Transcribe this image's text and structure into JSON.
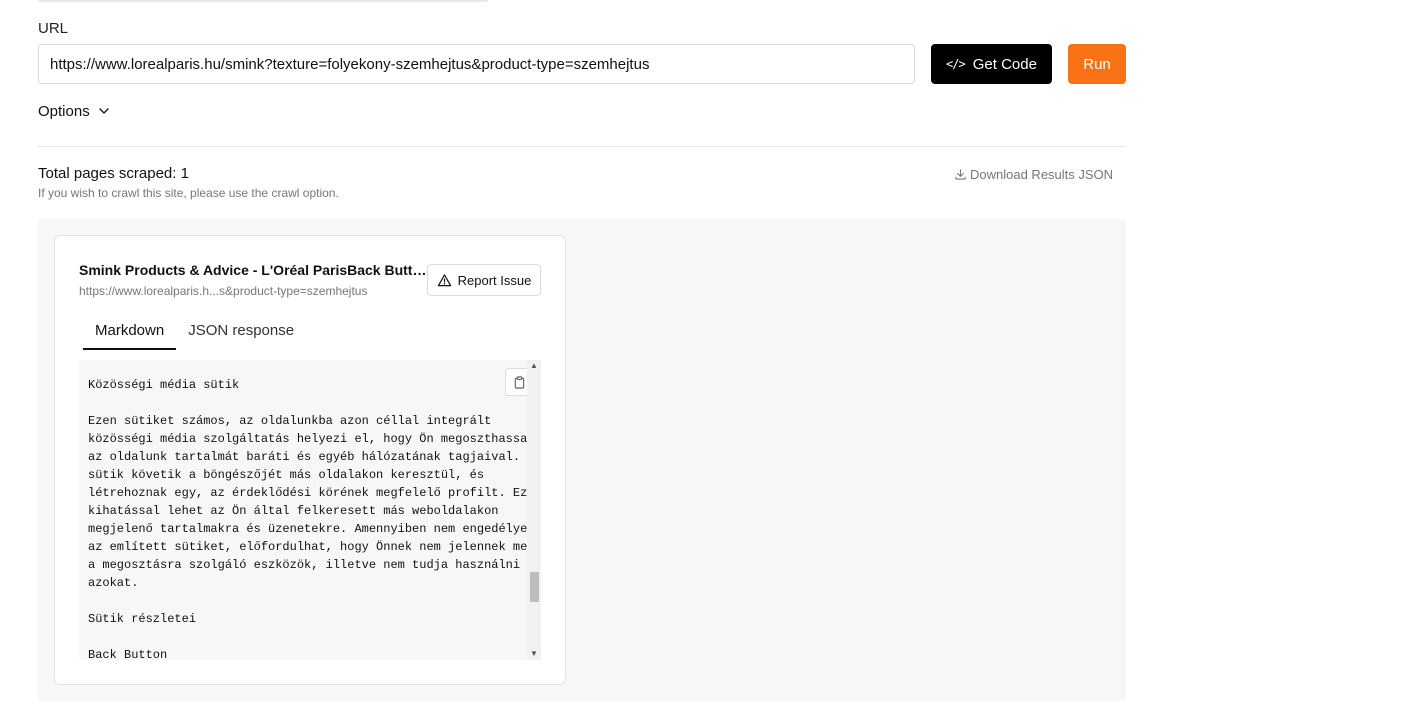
{
  "form": {
    "url_label": "URL",
    "url_value": "https://www.lorealparis.hu/smink?texture=folyekony-szemhejtus&product-type=szemhejtus",
    "get_code_label": "Get Code",
    "run_label": "Run",
    "options_label": "Options"
  },
  "summary": {
    "total_pages": "Total pages scraped: 1",
    "crawl_hint": "If you wish to crawl this site, please use the crawl option.",
    "download_label": "Download Results JSON"
  },
  "result": {
    "title": "Smink Products & Advice - L'Oréal ParisBack Button Search Icon",
    "url": "https://www.lorealparis.h...s&product-type=szemhejtus",
    "report_label": "Report Issue",
    "tabs": [
      {
        "label": "Markdown",
        "active": true
      },
      {
        "label": "JSON response",
        "active": false
      }
    ],
    "markdown": "Közösségi média sütik\n\nEzen sütiket számos, az oldalunkba azon céllal integrált\nközösségi média szolgáltatás helyezi el, hogy Ön megoszthassa\naz oldalunk tartalmát baráti és egyéb hálózatának tagjaival. A\nsütik követik a böngészőjét más oldalakon keresztül, és\nlétrehoznak egy, az érdeklődési körének megfelelő profilt. Ez\nkihatással lehet az Ön által felkeresett más weboldalakon\nmegjelenő tartalmakra és üzenetekre. Amennyiben nem engedélyezi\naz említett sütiket, előfordulhat, hogy Önnek nem jelennek meg\na megosztásra szolgáló eszközök, illetve nem tudja használni\nazokat.\n\nSütik részletei\n\nBack Button"
  },
  "colors": {
    "run": "#f97316",
    "get_code": "#000000",
    "panel_bg": "#f7f7f7"
  },
  "icons": [
    "code-icon",
    "chevron-down-icon",
    "download-icon",
    "warning-icon",
    "clipboard-icon"
  ]
}
